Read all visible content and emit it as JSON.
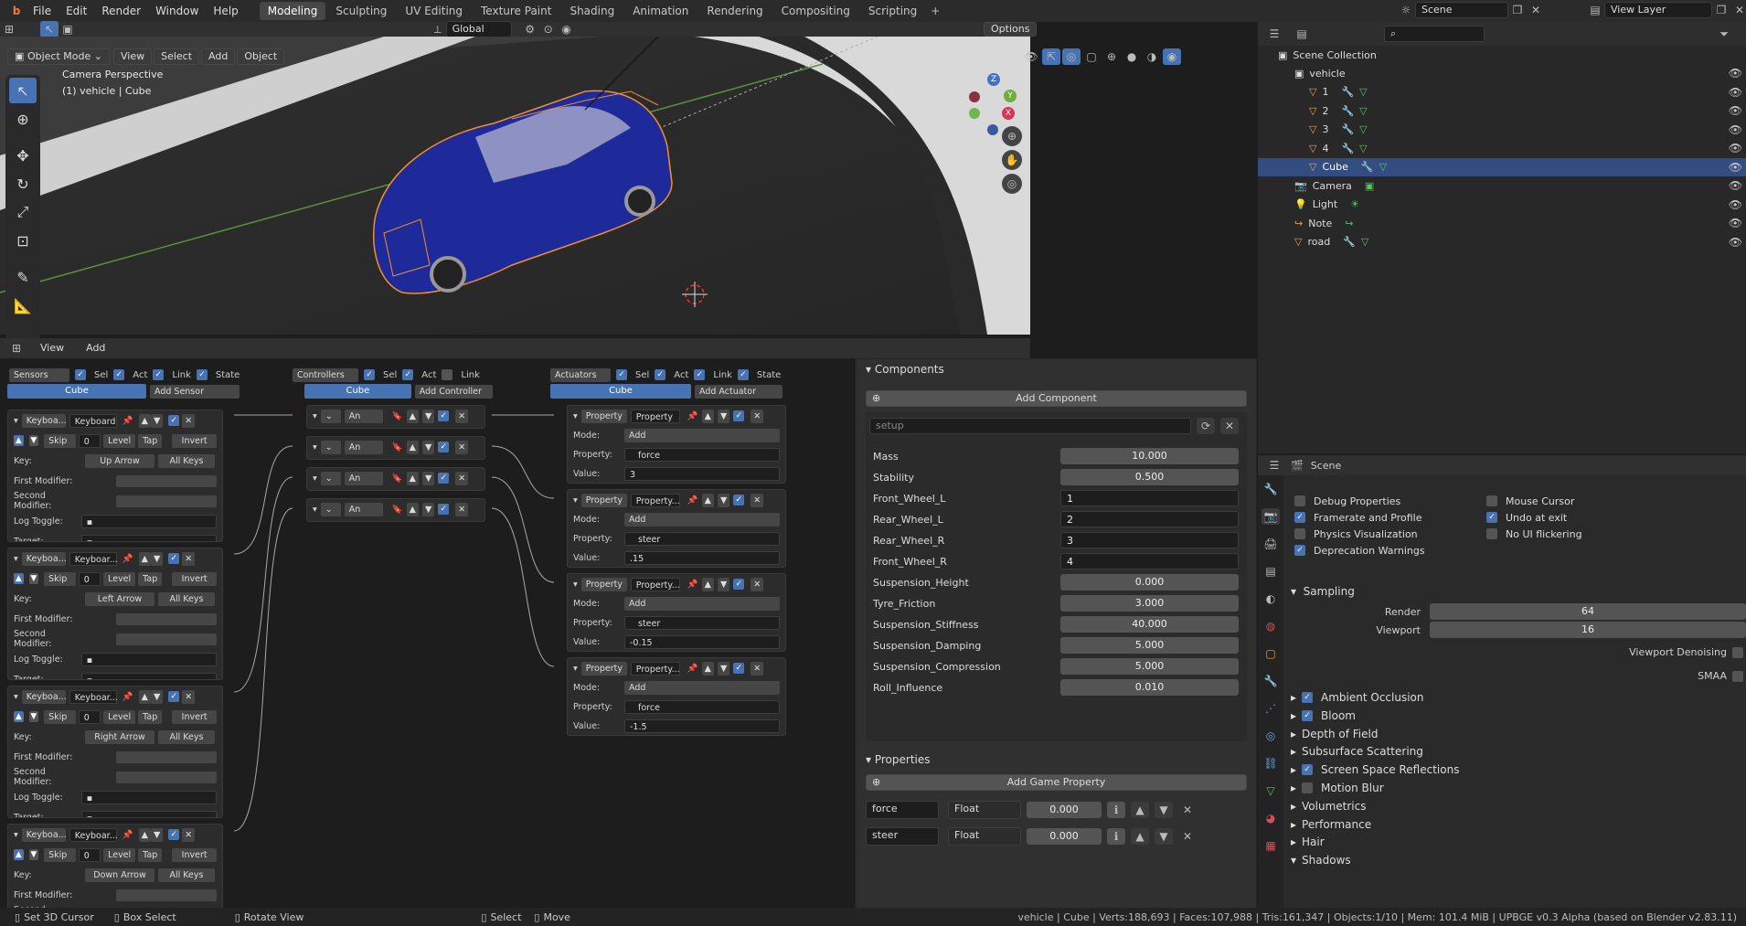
{
  "topbar": {
    "menus": [
      "File",
      "Edit",
      "Render",
      "Window",
      "Help"
    ],
    "workspaces": [
      "Modeling",
      "Sculpting",
      "UV Editing",
      "Texture Paint",
      "Shading",
      "Animation",
      "Rendering",
      "Compositing",
      "Scripting"
    ],
    "active_workspace": "Modeling",
    "scene": "Scene",
    "view_layer": "View Layer"
  },
  "viewport_header": {
    "transform": "Global",
    "options": "Options",
    "mode": "Object Mode",
    "menus": [
      "View",
      "Select",
      "Add",
      "Object"
    ]
  },
  "viewport": {
    "overlay_line1": "Camera Perspective",
    "overlay_line2": "(1) vehicle | Cube",
    "axis_labels": {
      "z": "Z",
      "y": "Y",
      "x": "X"
    }
  },
  "outliner": {
    "root": "Scene Collection",
    "items": [
      {
        "label": "vehicle",
        "type": "collection"
      },
      {
        "label": "1",
        "type": "mesh"
      },
      {
        "label": "2",
        "type": "mesh"
      },
      {
        "label": "3",
        "type": "mesh"
      },
      {
        "label": "4",
        "type": "mesh"
      },
      {
        "label": "Cube",
        "type": "mesh",
        "selected": true
      },
      {
        "label": "Camera",
        "type": "camera"
      },
      {
        "label": "Light",
        "type": "light"
      },
      {
        "label": "Note",
        "type": "curve"
      },
      {
        "label": "road",
        "type": "mesh"
      }
    ]
  },
  "logic": {
    "menus": [
      "View",
      "Add"
    ],
    "sensors": {
      "dropdown": "Sensors",
      "sel": "Sel",
      "act": "Act",
      "link": "Link",
      "state": "State",
      "object": "Cube",
      "add": "Add Sensor"
    },
    "controllers": {
      "dropdown": "Controllers",
      "sel": "Sel",
      "act": "Act",
      "link": "Link",
      "object": "Cube",
      "add": "Add Controller"
    },
    "actuators": {
      "dropdown": "Actuators",
      "sel": "Sel",
      "act": "Act",
      "link": "Link",
      "state": "State",
      "object": "Cube",
      "add": "Add Actuator"
    },
    "sensor_bricks": [
      {
        "type": "Keyboa...",
        "name": "Keyboard",
        "skip": "Skip",
        "skip_val": "0",
        "level": "Level",
        "tap": "Tap",
        "invert": "Invert",
        "key_label": "Key:",
        "key": "Up Arrow",
        "all_keys": "All Keys",
        "first_mod": "First Modifier:",
        "second_mod": "Second Modifier:",
        "log_toggle": "Log Toggle:",
        "target": "Target:"
      },
      {
        "type": "Keyboa...",
        "name": "Keyboar...",
        "skip": "Skip",
        "skip_val": "0",
        "level": "Level",
        "tap": "Tap",
        "invert": "Invert",
        "key_label": "Key:",
        "key": "Left Arrow",
        "all_keys": "All Keys",
        "first_mod": "First Modifier:",
        "second_mod": "Second Modifier:",
        "log_toggle": "Log Toggle:",
        "target": "Target:"
      },
      {
        "type": "Keyboa...",
        "name": "Keyboar...",
        "skip": "Skip",
        "skip_val": "0",
        "level": "Level",
        "tap": "Tap",
        "invert": "Invert",
        "key_label": "Key:",
        "key": "Right Arrow",
        "all_keys": "All Keys",
        "first_mod": "First Modifier:",
        "second_mod": "Second Modifier:",
        "log_toggle": "Log Toggle:",
        "target": "Target:"
      },
      {
        "type": "Keyboa...",
        "name": "Keyboar...",
        "skip": "Skip",
        "skip_val": "0",
        "level": "Level",
        "tap": "Tap",
        "invert": "Invert",
        "key_label": "Key:",
        "key": "Down Arrow",
        "all_keys": "All Keys",
        "first_mod": "First Modifier:",
        "second_mod": "Second Modifier:"
      }
    ],
    "controller_bricks": [
      "An",
      "An",
      "An",
      "An"
    ],
    "actuator_bricks": [
      {
        "type": "Property",
        "name": "Property",
        "mode_label": "Mode:",
        "mode": "Add",
        "prop_label": "Property:",
        "prop": "force",
        "value_label": "Value:",
        "value": "3"
      },
      {
        "type": "Property",
        "name": "Property...",
        "mode_label": "Mode:",
        "mode": "Add",
        "prop_label": "Property:",
        "prop": "steer",
        "value_label": "Value:",
        "value": ".15"
      },
      {
        "type": "Property",
        "name": "Property...",
        "mode_label": "Mode:",
        "mode": "Add",
        "prop_label": "Property:",
        "prop": "steer",
        "value_label": "Value:",
        "value": "-0.15"
      },
      {
        "type": "Property",
        "name": "Property...",
        "mode_label": "Mode:",
        "mode": "Add",
        "prop_label": "Property:",
        "prop": "force",
        "value_label": "Value:",
        "value": "-1.5"
      }
    ]
  },
  "components": {
    "title": "Components",
    "add": "Add Component",
    "setup": "setup",
    "props": [
      {
        "label": "Mass",
        "value": "10.000",
        "kind": "num"
      },
      {
        "label": "Stability",
        "value": "0.500",
        "kind": "num"
      },
      {
        "label": "Front_Wheel_L",
        "value": "1",
        "kind": "text"
      },
      {
        "label": "Rear_Wheel_L",
        "value": "2",
        "kind": "text"
      },
      {
        "label": "Rear_Wheel_R",
        "value": "3",
        "kind": "text"
      },
      {
        "label": "Front_Wheel_R",
        "value": "4",
        "kind": "text"
      },
      {
        "label": "Suspension_Height",
        "value": "0.000",
        "kind": "num"
      },
      {
        "label": "Tyre_Friction",
        "value": "3.000",
        "kind": "num"
      },
      {
        "label": "Suspension_Stiffness",
        "value": "40.000",
        "kind": "num"
      },
      {
        "label": "Suspension_Damping",
        "value": "5.000",
        "kind": "num"
      },
      {
        "label": "Suspension_Compression",
        "value": "5.000",
        "kind": "num"
      },
      {
        "label": "Roll_Influence",
        "value": "0.010",
        "kind": "num"
      }
    ],
    "properties_title": "Properties",
    "add_game_property": "Add Game Property",
    "game_props": [
      {
        "name": "force",
        "type": "Float",
        "value": "0.000"
      },
      {
        "name": "steer",
        "type": "Float",
        "value": "0.000"
      }
    ]
  },
  "render_props": {
    "header": "Scene",
    "checks": [
      {
        "label": "Debug Properties",
        "checked": false
      },
      {
        "label": "Mouse Cursor",
        "checked": false
      },
      {
        "label": "Framerate and Profile",
        "checked": true
      },
      {
        "label": "Undo at exit",
        "checked": true
      },
      {
        "label": "Physics Visualization",
        "checked": false
      },
      {
        "label": "No UI flickering",
        "checked": false
      },
      {
        "label": "Deprecation Warnings",
        "checked": true
      }
    ],
    "sampling": "Sampling",
    "render_label": "Render",
    "render_val": "64",
    "viewport_label": "Viewport",
    "viewport_val": "16",
    "viewport_denoising": "Viewport Denoising",
    "smaa": "SMAA",
    "sections": [
      {
        "label": "Ambient Occlusion",
        "check": true
      },
      {
        "label": "Bloom",
        "check": true
      },
      {
        "label": "Depth of Field"
      },
      {
        "label": "Subsurface Scattering"
      },
      {
        "label": "Screen Space Reflections",
        "check": true
      },
      {
        "label": "Motion Blur",
        "check": false
      },
      {
        "label": "Volumetrics"
      },
      {
        "label": "Performance"
      },
      {
        "label": "Hair"
      },
      {
        "label": "Shadows"
      }
    ]
  },
  "statusbar": {
    "items": [
      "Set 3D Cursor",
      "Box Select",
      "Rotate View",
      "Select",
      "Move"
    ],
    "info": "vehicle | Cube | Verts:188,693 | Faces:107,988 | Tris:161,347 | Objects:1/10 | Mem: 101.4 MiB | UPBGE v0.3 Alpha (based on Blender v2.83.11)"
  }
}
